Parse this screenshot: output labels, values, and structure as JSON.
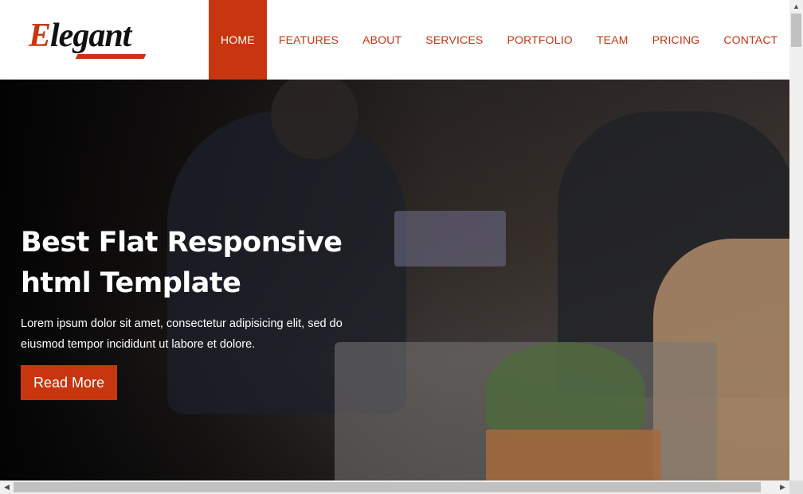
{
  "brand": {
    "first_letter": "E",
    "rest": "legant",
    "accent": "#c8360f"
  },
  "nav": {
    "items": [
      {
        "label": "HOME",
        "active": true
      },
      {
        "label": "FEATURES"
      },
      {
        "label": "ABOUT"
      },
      {
        "label": "SERVICES"
      },
      {
        "label": "PORTFOLIO"
      },
      {
        "label": "TEAM"
      },
      {
        "label": "PRICING"
      },
      {
        "label": "CONTACT"
      }
    ]
  },
  "hero": {
    "title_line1": "Best Flat Responsive",
    "title_line2": "html Template",
    "subtitle_line1": "Lorem ipsum dolor sit amet, consectetur adipisicing elit, sed do",
    "subtitle_line2": "eiusmod tempor incididunt ut labore et dolore.",
    "button_label": "Read More"
  },
  "scrollbar": {
    "up_icon": "arrow-up-icon",
    "down_icon": "arrow-down-icon",
    "left_icon": "arrow-left-icon",
    "right_icon": "arrow-right-icon"
  }
}
